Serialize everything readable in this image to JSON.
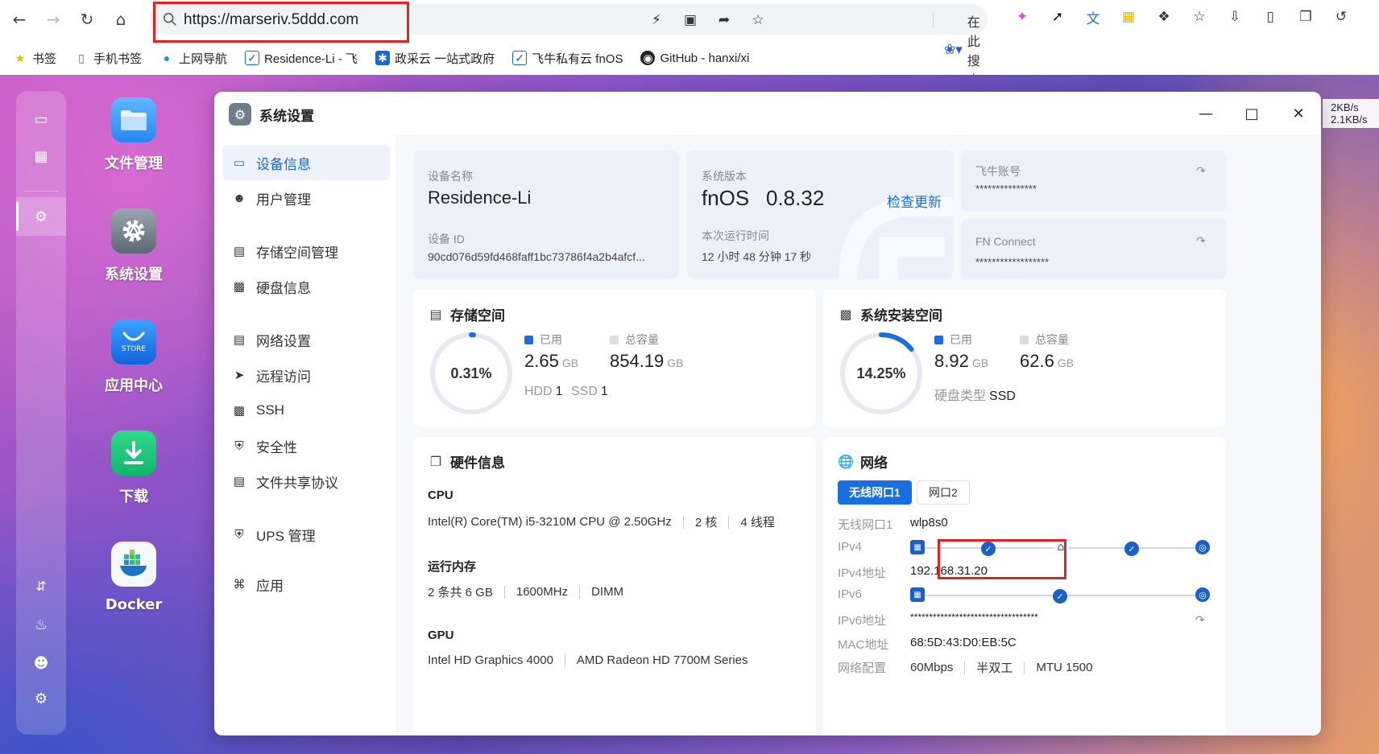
{
  "browser": {
    "url": "https://marseriv.5ddd.com",
    "search_hint": "在此搜索",
    "bookmarks": [
      {
        "label": "书签",
        "icon": "star-icon"
      },
      {
        "label": "手机书签",
        "icon": "phone-icon"
      },
      {
        "label": "上网导航",
        "icon": "browser-logo-icon"
      },
      {
        "label": "Residence-Li - 飞",
        "icon": "fnos-icon"
      },
      {
        "label": "政采云 一站式政府",
        "icon": "zcy-icon"
      },
      {
        "label": "飞牛私有云 fnOS",
        "icon": "fnos-icon"
      },
      {
        "label": "GitHub - hanxi/xi",
        "icon": "github-icon"
      }
    ]
  },
  "desktop": {
    "apps": [
      {
        "label": "文件管理",
        "icon": "folder-icon"
      },
      {
        "label": "系统设置",
        "icon": "settings-gear-icon"
      },
      {
        "label": "应用中心",
        "icon": "store-icon",
        "badge": "STORE"
      },
      {
        "label": "下载",
        "icon": "download-icon"
      },
      {
        "label": "Docker",
        "icon": "docker-icon"
      }
    ],
    "net_speed": {
      "up": "2KB/s",
      "down": "2.1KB/s"
    }
  },
  "window": {
    "title": "系统设置",
    "nav": [
      {
        "label": "设备信息",
        "icon": "device-icon",
        "active": true
      },
      {
        "label": "用户管理",
        "icon": "user-icon"
      },
      {
        "label": "存储空间管理",
        "icon": "storage-icon"
      },
      {
        "label": "硬盘信息",
        "icon": "disk-icon"
      },
      {
        "label": "网络设置",
        "icon": "network-icon"
      },
      {
        "label": "远程访问",
        "icon": "remote-icon"
      },
      {
        "label": "SSH",
        "icon": "terminal-icon"
      },
      {
        "label": "安全性",
        "icon": "shield-icon"
      },
      {
        "label": "文件共享协议",
        "icon": "file-share-icon"
      },
      {
        "label": "UPS 管理",
        "icon": "ups-icon"
      },
      {
        "label": "应用",
        "icon": "apps-icon"
      }
    ],
    "device": {
      "name_label": "设备名称",
      "name": "Residence-Li",
      "id_label": "设备 ID",
      "id": "90cd076d59fd468faff1bc73786f4a2b4afcf..."
    },
    "system": {
      "version_label": "系统版本",
      "os": "fnOS",
      "version": "0.8.32",
      "check_update": "检查更新",
      "uptime_label": "本次运行时间",
      "uptime": "12 小时 48 分钟 17 秒"
    },
    "account": {
      "label": "飞牛账号",
      "value": "***************",
      "fn_connect_label": "FN Connect",
      "fn_connect_value": "******************"
    },
    "storage": {
      "title": "存储空间",
      "percent_text": "0.31%",
      "used_fraction": 0.0031,
      "used_label": "已用",
      "used_value": "2.65",
      "used_unit": "GB",
      "total_label": "总容量",
      "total_value": "854.19",
      "total_unit": "GB",
      "hdd_label": "HDD",
      "hdd_count": "1",
      "ssd_label": "SSD",
      "ssd_count": "1"
    },
    "sys_storage": {
      "title": "系统安装空间",
      "percent_text": "14.25%",
      "used_fraction": 0.1425,
      "used_label": "已用",
      "used_value": "8.92",
      "used_unit": "GB",
      "total_label": "总容量",
      "total_value": "62.6",
      "total_unit": "GB",
      "disk_type_label": "硬盘类型",
      "disk_type": "SSD"
    },
    "hardware": {
      "title": "硬件信息",
      "cpu_label": "CPU",
      "cpu_model": "Intel(R) Core(TM) i5-3210M CPU @ 2.50GHz",
      "cpu_cores": "2 核",
      "cpu_threads": "4 线程",
      "mem_label": "运行内存",
      "mem_size": "2 条共 6 GB",
      "mem_speed": "1600MHz",
      "mem_type": "DIMM",
      "gpu_label": "GPU",
      "gpu1": "Intel HD Graphics 4000",
      "gpu2": "AMD Radeon HD 7700M Series"
    },
    "network": {
      "title": "网络",
      "tabs": [
        "无线网口1",
        "网口2"
      ],
      "iface_label": "无线网口1",
      "iface": "wlp8s0",
      "ipv4_label": "IPv4",
      "ipv4_addr_label": "IPv4地址",
      "ipv4_addr": "192.168.31.20",
      "ipv6_label": "IPv6",
      "ipv6_addr_label": "IPv6地址",
      "ipv6_addr": "**********************************",
      "mac_label": "MAC地址",
      "mac": "68:5D:43:D0:EB:5C",
      "config_label": "网络配置",
      "speed": "60Mbps",
      "duplex": "半双工",
      "mtu": "MTU 1500"
    }
  },
  "colors": {
    "accent": "#1a6fe0",
    "highlight": "#e32222"
  }
}
